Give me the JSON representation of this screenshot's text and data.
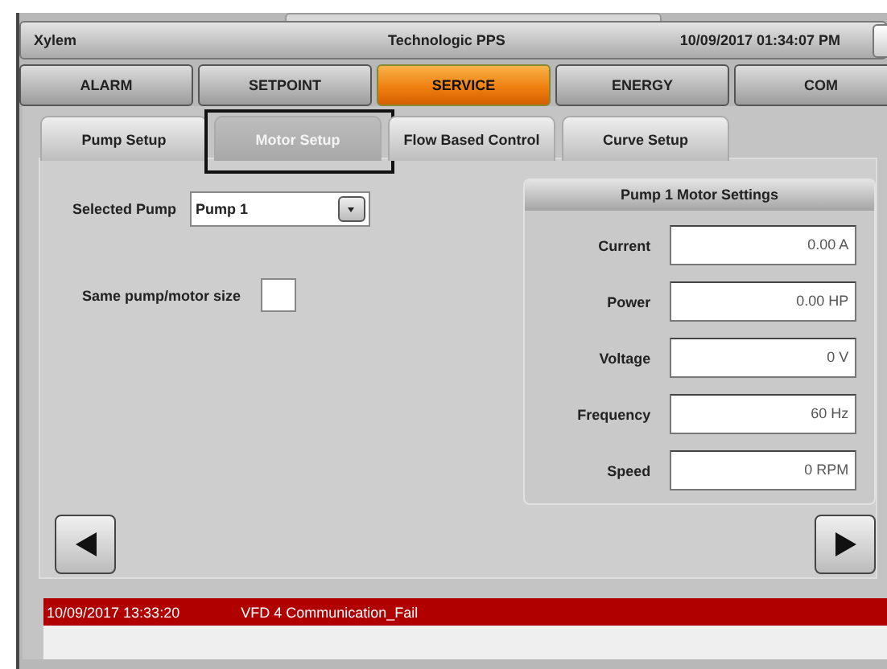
{
  "header": {
    "brand": "Xylem",
    "title": "Technologic PPS",
    "datetime": "10/09/2017 01:34:07 PM"
  },
  "main_tabs": [
    {
      "label": "ALARM",
      "selected": false
    },
    {
      "label": "SETPOINT",
      "selected": false
    },
    {
      "label": "SERVICE",
      "selected": true
    },
    {
      "label": "ENERGY",
      "selected": false
    },
    {
      "label": "COM",
      "selected": false
    }
  ],
  "sub_tabs": [
    {
      "label": "Pump Setup",
      "selected": false,
      "highlighted": false
    },
    {
      "label": "Motor Setup",
      "selected": true,
      "highlighted": true
    },
    {
      "label": "Flow Based Control",
      "selected": false,
      "highlighted": false
    },
    {
      "label": "Curve Setup",
      "selected": false,
      "highlighted": false
    }
  ],
  "selected_pump": {
    "label": "Selected Pump",
    "value": "Pump 1"
  },
  "same_size": {
    "label": "Same pump/motor size",
    "checked": false
  },
  "motor_settings": {
    "title": "Pump 1  Motor Settings",
    "rows": [
      {
        "label": "Current",
        "value": "0.00 A"
      },
      {
        "label": "Power",
        "value": "0.00 HP"
      },
      {
        "label": "Voltage",
        "value": "0 V"
      },
      {
        "label": "Frequency",
        "value": "60 Hz"
      },
      {
        "label": "Speed",
        "value": "0 RPM"
      }
    ]
  },
  "alarms": [
    {
      "time": "10/09/2017 13:33:20",
      "message": "VFD 4 Communication_Fail",
      "active": true
    }
  ]
}
